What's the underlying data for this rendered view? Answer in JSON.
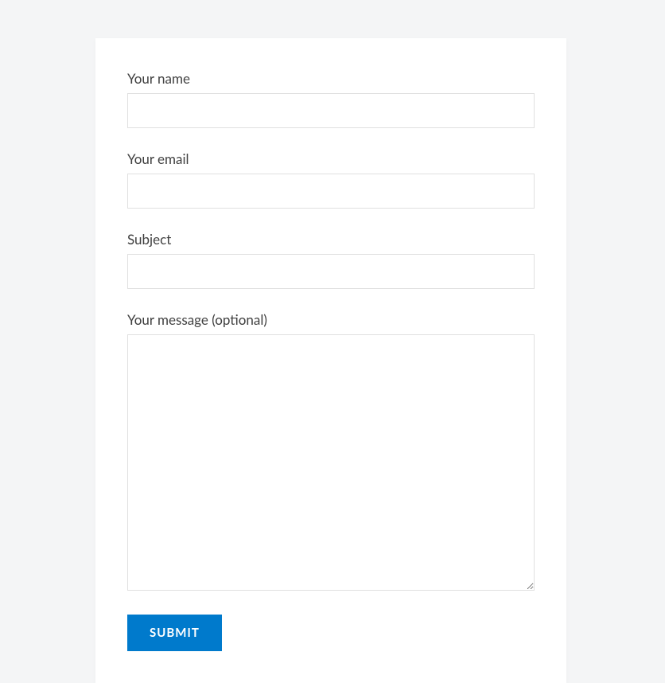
{
  "form": {
    "fields": {
      "name": {
        "label": "Your name",
        "value": ""
      },
      "email": {
        "label": "Your email",
        "value": ""
      },
      "subject": {
        "label": "Subject",
        "value": ""
      },
      "message": {
        "label": "Your message (optional)",
        "value": ""
      }
    },
    "submit_label": "Submit"
  }
}
